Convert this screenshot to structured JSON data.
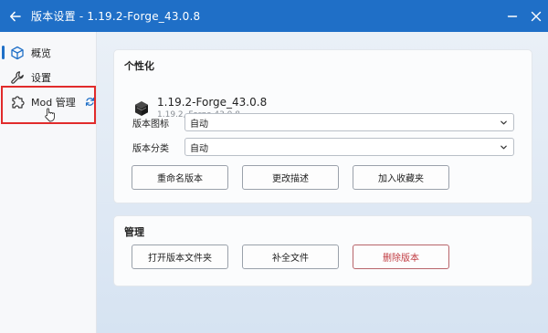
{
  "window": {
    "title": "版本设置 - 1.19.2-Forge_43.0.8",
    "accent": "#1f6fc7"
  },
  "sidebar": {
    "items": [
      {
        "label": "概览",
        "icon": "cube-icon",
        "active": true
      },
      {
        "label": "设置",
        "icon": "wrench-icon",
        "active": false
      },
      {
        "label": "Mod 管理",
        "icon": "puzzle-icon",
        "active": false
      }
    ],
    "refresh_icon": "refresh-icon",
    "highlight_color": "#e12b2b"
  },
  "personalize": {
    "title": "个性化",
    "version_name": "1.19.2-Forge_43.0.8",
    "version_sub": "1.19.2, Forge 43.0.8",
    "icon_label": "版本图标",
    "icon_value": "自动",
    "category_label": "版本分类",
    "category_value": "自动",
    "buttons": {
      "rename": "重命名版本",
      "edit_desc": "更改描述",
      "favorite": "加入收藏夹"
    }
  },
  "manage": {
    "title": "管理",
    "buttons": {
      "open_folder": "打开版本文件夹",
      "complete_files": "补全文件",
      "delete": "删除版本"
    },
    "danger_color": "#c03a40"
  }
}
